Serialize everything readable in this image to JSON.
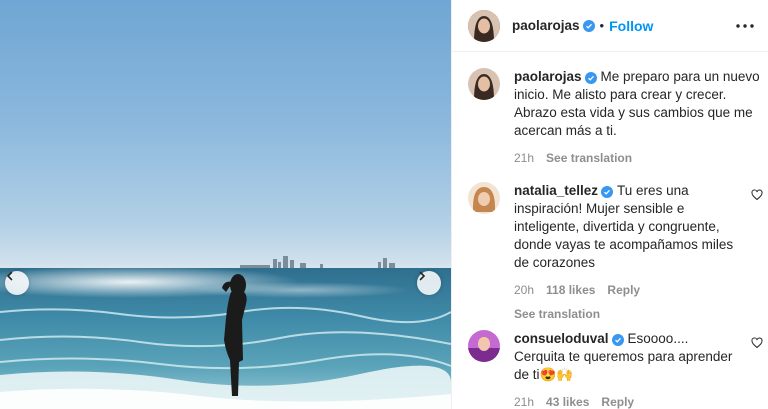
{
  "post": {
    "username": "paolarojas",
    "follow_label": "Follow",
    "dot": "•"
  },
  "comments": [
    {
      "username": "paolarojas",
      "text": "Me preparo para un nuevo inicio. Me alisto para crear y crecer. Abrazo esta vida y sus cambios que me acercan más a ti.",
      "time": "21h",
      "see_translation": "See translation",
      "avatar_color": "#7a5a48"
    },
    {
      "username": "natalia_tellez",
      "text": "Tu eres una inspiración! Mujer sensible e inteligente, divertida y congruente, donde vayas te acompañamos miles de corazones",
      "time": "20h",
      "likes": "118 likes",
      "reply": "Reply",
      "see_translation": "See translation",
      "avatar_color": "#c6864f"
    },
    {
      "username": "consueloduval",
      "text": "Esoooo.... Cerquita te queremos para aprender de ti😍🙌",
      "time": "21h",
      "likes": "43 likes",
      "reply": "Reply",
      "avatar_color": "#a04ab0"
    }
  ],
  "icons": {
    "prev": "chevron-left-icon",
    "next": "chevron-right-icon",
    "more": "more-horizontal-icon",
    "heart": "heart-icon",
    "verified": "verified-badge-icon"
  },
  "colors": {
    "link": "#0095f6",
    "muted": "#8e8e8e",
    "verified": "#3897f0",
    "text": "#262626"
  }
}
